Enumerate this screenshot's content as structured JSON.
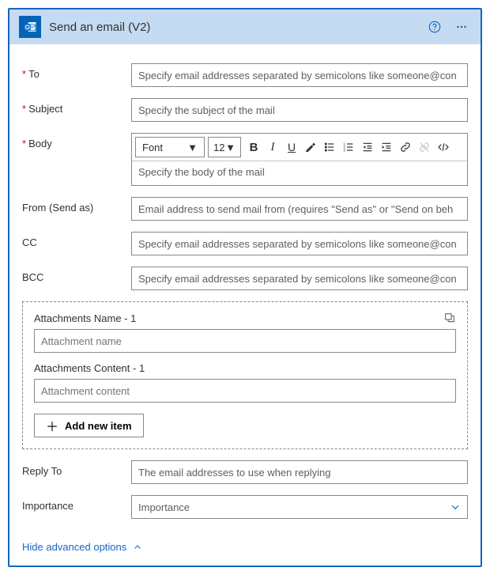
{
  "header": {
    "title": "Send an email (V2)"
  },
  "fields": {
    "to": {
      "label": "To",
      "placeholder": "Specify email addresses separated by semicolons like someone@con"
    },
    "subject": {
      "label": "Subject",
      "placeholder": "Specify the subject of the mail"
    },
    "body": {
      "label": "Body",
      "placeholder": "Specify the body of the mail"
    },
    "from": {
      "label": "From (Send as)",
      "placeholder": "Email address to send mail from (requires \"Send as\" or \"Send on beh"
    },
    "cc": {
      "label": "CC",
      "placeholder": "Specify email addresses separated by semicolons like someone@con"
    },
    "bcc": {
      "label": "BCC",
      "placeholder": "Specify email addresses separated by semicolons like someone@con"
    },
    "replyTo": {
      "label": "Reply To",
      "placeholder": "The email addresses to use when replying"
    },
    "importance": {
      "label": "Importance",
      "placeholder": "Importance"
    }
  },
  "richToolbar": {
    "font": "Font",
    "size": "12"
  },
  "attachments": {
    "nameLabel": "Attachments Name - 1",
    "namePlaceholder": "Attachment name",
    "contentLabel": "Attachments Content - 1",
    "contentPlaceholder": "Attachment content",
    "addItem": "Add new item"
  },
  "advancedToggle": "Hide advanced options"
}
